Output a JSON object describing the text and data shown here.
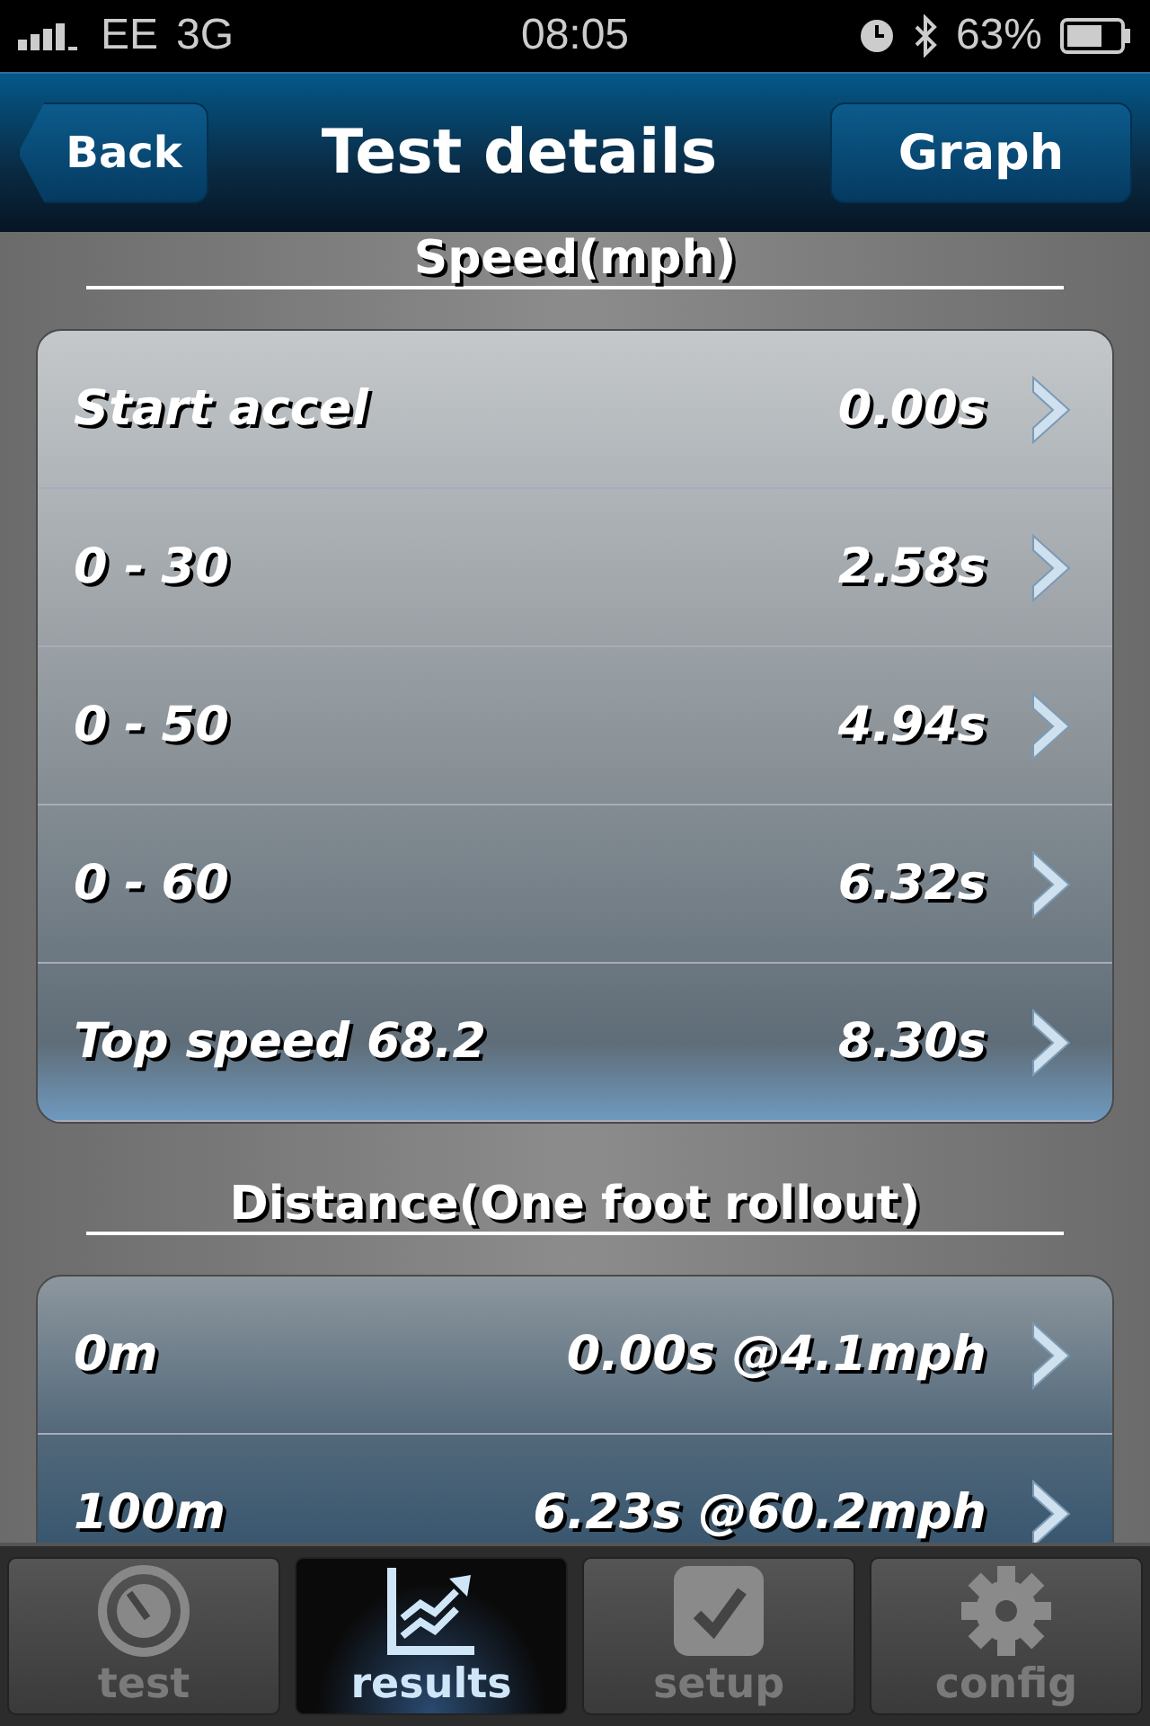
{
  "status_bar": {
    "carrier": "EE",
    "network": "3G",
    "time": "08:05",
    "battery": "63%"
  },
  "nav": {
    "back": "Back",
    "title": "Test details",
    "action": "Graph"
  },
  "sections": [
    {
      "title": "Speed(mph)",
      "rows": [
        {
          "label": "Start accel",
          "value": "0.00s"
        },
        {
          "label": "0 - 30",
          "value": "2.58s"
        },
        {
          "label": "0 - 50",
          "value": "4.94s"
        },
        {
          "label": "0 - 60",
          "value": "6.32s"
        },
        {
          "label": "Top speed 68.2",
          "value": "8.30s"
        }
      ]
    },
    {
      "title": "Distance(One foot rollout)",
      "rows": [
        {
          "label": "0m",
          "value": "0.00s @4.1mph"
        },
        {
          "label": "100m",
          "value": "6.23s @60.2mph"
        }
      ]
    }
  ],
  "tabs": [
    {
      "kind": "gauge",
      "label": "test",
      "selected": false
    },
    {
      "kind": "chart",
      "label": "results",
      "selected": true
    },
    {
      "kind": "check",
      "label": "setup",
      "selected": false
    },
    {
      "kind": "gear",
      "label": "config",
      "selected": false
    }
  ]
}
